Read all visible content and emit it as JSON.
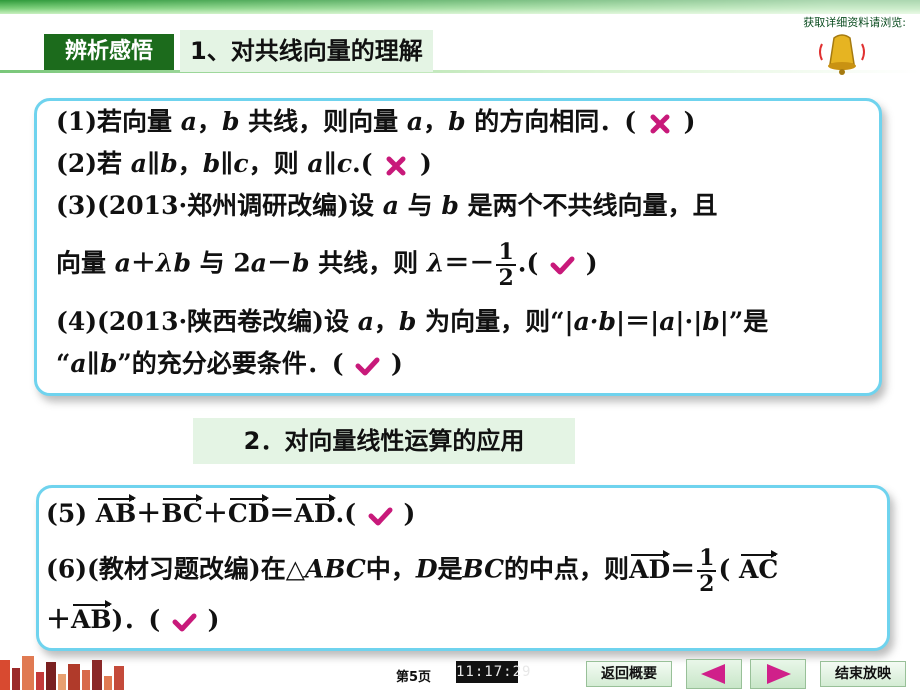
{
  "header": {
    "top_link": "获取详细资料请浏览:",
    "badge": "辨析感悟",
    "section1_title": "1、对共线向量的理解",
    "section2_title": "2．对向量线性运算的应用"
  },
  "colors": {
    "accent": "#6fd3ee",
    "badge_bg": "#1c6b1c",
    "wrong_mark": "#c8197a",
    "right_mark": "#c8197a"
  },
  "items": {
    "i1": {
      "a": "(1)若向量 ",
      "v1": "a",
      "b": "，",
      "v2": "b",
      "c": " 共线，则向量 ",
      "v3": "a",
      "d": "，",
      "v4": "b",
      "e": " 的方向相同．(",
      "f": ")",
      "mark": "cross-icon"
    },
    "i2": {
      "a": "(2)若 ",
      "v1": "a",
      "b": "∥",
      "v2": "b",
      "c": "，",
      "v3": "b",
      "d": "∥",
      "v4": "c",
      "e": "，则 ",
      "v5": "a",
      "f": "∥",
      "v6": "c",
      "g": ".(",
      "h": ")",
      "mark": "cross-icon"
    },
    "i3": {
      "a": "(3)(2013·郑州调研改编)设 ",
      "v1": "a",
      "b": " 与 ",
      "v2": "b",
      "c": " 是两个不共线向量，且",
      "l2a": "向量 ",
      "l2v1": "a",
      "l2b": "＋",
      "l2v2": "λb",
      "l2c": " 与 2",
      "l2v3": "a",
      "l2d": "－",
      "l2v4": "b",
      "l2e": " 共线，则 ",
      "l2v5": "λ",
      "l2f": "＝－",
      "frac_num": "1",
      "frac_den": "2",
      "l2g": ".(",
      "l2h": ")",
      "mark": "check-icon"
    },
    "i4": {
      "a": "(4)(2013·陕西卷改编)设 ",
      "v1": "a",
      "b": "，",
      "v2": "b",
      "c": " 为向量，则“|",
      "v3": "a·b",
      "d": "|＝|",
      "v4": "a",
      "e": "|·|",
      "v5": "b",
      "f": "|”是",
      "l2a": "“",
      "l2v1": "a",
      "l2b": "∥",
      "l2v2": "b",
      "l2c": "”的充分必要条件．(",
      "l2d": ")",
      "mark": "check-icon"
    },
    "i5": {
      "a": "(5) ",
      "v1": "AB",
      "b": "＋",
      "v2": "BC",
      "c": "＋",
      "v3": "CD",
      "d": "＝",
      "v4": "AD",
      "e": ".(",
      "f": ")",
      "mark": "check-icon"
    },
    "i6": {
      "a": "(6)(教材习题改编)在△",
      "v1": "ABC",
      "b": "中，",
      "v2": "D",
      "c": "是",
      "v3": "BC",
      "d": "的中点，则",
      "v4": "AD",
      "e": "＝",
      "frac_num": "1",
      "frac_den": "2",
      "f": "( ",
      "v5": "AC",
      "l2a": "＋",
      "l2v1": "AB",
      "l2b": ")．(",
      "l2c": ")",
      "mark": "check-icon"
    }
  },
  "footer": {
    "page": "第5页",
    "clock": "11:17:29",
    "back_label": "返回概要",
    "end_label": "结束放映",
    "prev_icon": "triangle-left-icon",
    "next_icon": "triangle-right-icon"
  }
}
